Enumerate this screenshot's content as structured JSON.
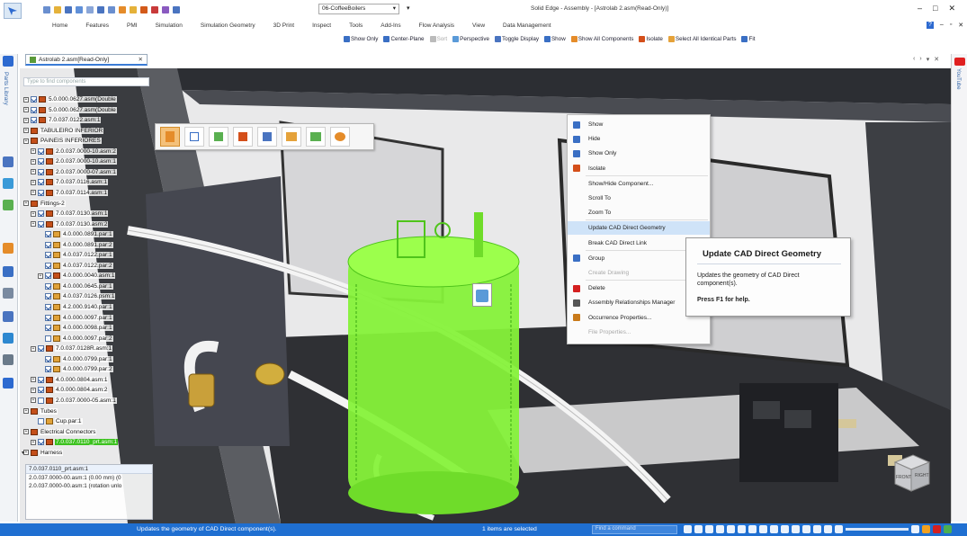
{
  "window": {
    "title": "Solid Edge - Assembly - [Astrolab 2.asm(Read-Only)]",
    "document_selector": "06-CoffeeBoilers",
    "controls": [
      "–",
      "□",
      "✕"
    ]
  },
  "ribbon_tabs": [
    "Home",
    "Features",
    "PMI",
    "Simulation",
    "Simulation Geometry",
    "3D Print",
    "Inspect",
    "Tools",
    "Add-Ins",
    "Flow Analysis",
    "View",
    "Data Management"
  ],
  "command_bar": [
    "Show Only",
    "Center-Plane",
    "Sort",
    "Perspective",
    "Toggle Display",
    "Show",
    "Show All Components",
    "Isolate",
    "Select All Identical Parts",
    "Fit"
  ],
  "left_rail_label": "Parts Library",
  "right_rail_label": "YouTube",
  "doc_tab": "Astrolab 2.asm[Read-Only]",
  "tree": {
    "search_placeholder": "Type to find components",
    "rows": [
      {
        "label": "5.0.000.0627.asm(Double",
        "indent": 0,
        "type": "asm",
        "checked": true
      },
      {
        "label": "5.0.000.0627.asm(Double",
        "indent": 0,
        "type": "asm",
        "checked": true
      },
      {
        "label": "7.0.037.0122.asm:1",
        "indent": 0,
        "type": "asm",
        "checked": true
      },
      {
        "label": "TABULEIRO INFERIOR",
        "indent": 0,
        "type": "group",
        "checked": false
      },
      {
        "label": "PAINEIS INFERIORES",
        "indent": 0,
        "type": "group",
        "checked": false
      },
      {
        "label": "2.0.037.0000-10.asm:2",
        "indent": 1,
        "type": "asm",
        "checked": true
      },
      {
        "label": "2.0.037.0000-10.asm:1",
        "indent": 1,
        "type": "asm",
        "checked": true
      },
      {
        "label": "2.0.037.0000-07.asm:1",
        "indent": 1,
        "type": "asm",
        "checked": true
      },
      {
        "label": "7.0.037.0116.asm:1",
        "indent": 1,
        "type": "asm",
        "checked": true
      },
      {
        "label": "7.0.037.0114.asm:1",
        "indent": 1,
        "type": "asm",
        "checked": true
      },
      {
        "label": "Fittings-2",
        "indent": 0,
        "type": "group",
        "checked": false
      },
      {
        "label": "7.0.037.0130.asm:1",
        "indent": 1,
        "type": "asm",
        "checked": true
      },
      {
        "label": "7.0.037.0130.asm:2",
        "indent": 1,
        "type": "asm",
        "checked": true
      },
      {
        "label": "4.0.000.0891.par:1",
        "indent": 2,
        "type": "prt",
        "checked": true
      },
      {
        "label": "4.0.000.0891.par:2",
        "indent": 2,
        "type": "prt",
        "checked": true
      },
      {
        "label": "4.0.037.0122.par:1",
        "indent": 2,
        "type": "prt",
        "checked": true
      },
      {
        "label": "4.0.037.0122.par:2",
        "indent": 2,
        "type": "prt",
        "checked": true
      },
      {
        "label": "4.0.000.0040.asm:1",
        "indent": 2,
        "type": "asm",
        "checked": true
      },
      {
        "label": "4.0.000.0645.par:1",
        "indent": 2,
        "type": "prt",
        "checked": true
      },
      {
        "label": "4.0.037.0126.psm:1",
        "indent": 2,
        "type": "prt",
        "checked": true
      },
      {
        "label": "4.2.000.9140.par:1",
        "indent": 2,
        "type": "prt",
        "checked": true
      },
      {
        "label": "4.0.000.0097.par:1",
        "indent": 2,
        "type": "prt",
        "checked": true
      },
      {
        "label": "4.0.000.0098.par:1",
        "indent": 2,
        "type": "prt",
        "checked": true
      },
      {
        "label": "4.0.000.0097.par:2",
        "indent": 2,
        "type": "prt",
        "checked": false
      },
      {
        "label": "7.0.037.0128R.asm:1",
        "indent": 1,
        "type": "asm",
        "checked": true
      },
      {
        "label": "4.0.000.0799.par:1",
        "indent": 2,
        "type": "prt",
        "checked": true
      },
      {
        "label": "4.0.000.0799.par:2",
        "indent": 2,
        "type": "prt",
        "checked": true
      },
      {
        "label": "4.0.000.0804.asm:1",
        "indent": 1,
        "type": "asm",
        "checked": true
      },
      {
        "label": "4.0.000.0804.asm:2",
        "indent": 1,
        "type": "asm",
        "checked": true
      },
      {
        "label": "2.0.037.0000-05.asm:1",
        "indent": 1,
        "type": "asm",
        "checked": false
      },
      {
        "label": "Tubes",
        "indent": 0,
        "type": "group",
        "checked": false
      },
      {
        "label": "Cup.par:1",
        "indent": 1,
        "type": "prt",
        "checked": false
      },
      {
        "label": "Electrical Connectors",
        "indent": 0,
        "type": "group",
        "checked": false
      },
      {
        "label": "7.0.037.0110_prt.asm:1",
        "indent": 1,
        "type": "asm",
        "checked": true,
        "selected": true
      },
      {
        "label": "Harness",
        "indent": 0,
        "type": "group",
        "checked": false
      }
    ]
  },
  "path_readout": {
    "header": "7.0.037.0110_prt.asm:1",
    "lines": [
      "2.0.037.0000-00.asm:1   (0.00 mm)   (0",
      "2.0.037.0000-00.asm:1   (rotation unlo"
    ]
  },
  "mini_toolbar": [
    "select",
    "copy",
    "move",
    "relate",
    "show",
    "color",
    "view",
    "display"
  ],
  "context_menu": {
    "items": [
      {
        "label": "Show",
        "color": "#3a6fc4",
        "state": "normal"
      },
      {
        "label": "Hide",
        "color": "#3a6fc4",
        "state": "normal"
      },
      {
        "label": "Show Only",
        "color": "#3a6fc4",
        "state": "normal"
      },
      {
        "label": "Isolate",
        "color": "#d44f1a",
        "state": "normal"
      },
      {
        "label": "Show/Hide Component...",
        "color": "",
        "state": "normal"
      },
      {
        "label": "Scroll To",
        "color": "",
        "state": "normal"
      },
      {
        "label": "Zoom To",
        "color": "",
        "state": "normal"
      },
      {
        "label": "Update CAD Direct Geometry",
        "color": "",
        "state": "highlight"
      },
      {
        "label": "Break CAD Direct Link",
        "color": "",
        "state": "normal"
      },
      {
        "label": "Group",
        "color": "#3a6fc4",
        "state": "normal"
      },
      {
        "label": "Create Drawing",
        "color": "",
        "state": "disabled"
      },
      {
        "label": "Delete",
        "color": "#d42020",
        "state": "normal"
      },
      {
        "label": "Assembly Relationships Manager",
        "color": "#555555",
        "state": "normal"
      },
      {
        "label": "Occurrence Properties...",
        "color": "#c97a1a",
        "state": "normal"
      },
      {
        "label": "File Properties...",
        "color": "",
        "state": "disabled"
      }
    ]
  },
  "tooltip": {
    "title": "Update CAD Direct Geometry",
    "body": "Updates the geometry of CAD Direct component(s).",
    "help": "Press F1 for help."
  },
  "viewcube": {
    "front": "FRONT",
    "right": "RIGHT"
  },
  "status_bar": {
    "message": "Updates the geometry of CAD Direct component(s).",
    "selection": "1 items are selected",
    "command_placeholder": "Find a command"
  },
  "colors": {
    "accent": "#1f6fd1",
    "highlight_green": "#7cff33",
    "frame_dark": "#2a2c30",
    "menu_highlight": "#cfe3f8"
  }
}
